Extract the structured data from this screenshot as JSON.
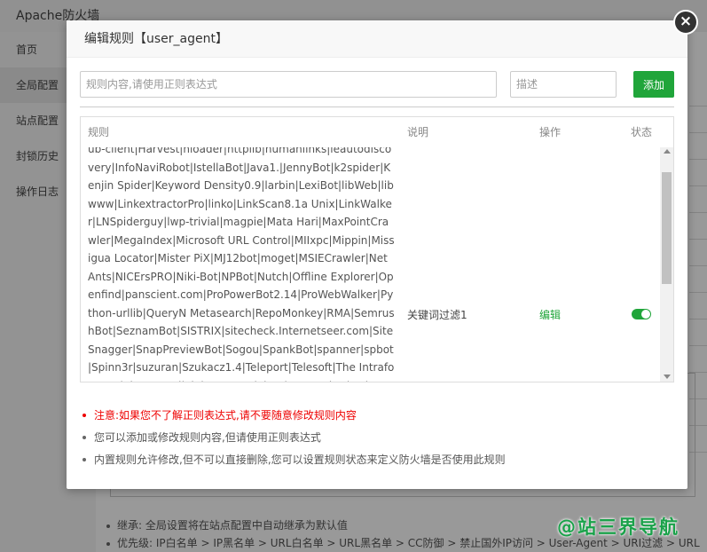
{
  "app": {
    "title": "Apache防火墙",
    "sidebar": [
      "首页",
      "全局配置",
      "站点配置",
      "封锁历史",
      "操作日志"
    ],
    "bottom_notes": [
      "继承: 全局设置将在站点配置中自动继承为默认值",
      "优先级: IP白名单 > IP黑名单 > URL白名单 > URL黑名单 > CC防御 > 禁止国外IP访问 > User-Agent > URI过滤 > URL"
    ],
    "bottom_fragment": "-Agent > URI过滤 > URL"
  },
  "watermark": "@站三界导航",
  "modal": {
    "title": "编辑规则【user_agent】",
    "close_symbol": "×",
    "rule_input": {
      "placeholder": "规则内容,请使用正则表达式",
      "value": ""
    },
    "desc_input": {
      "placeholder": "描述",
      "value": ""
    },
    "add_button": "添加",
    "table": {
      "headers": {
        "rule": "规则",
        "desc": "说明",
        "op": "操作",
        "status": "状态"
      },
      "rows": [
        {
          "rule": "ub-client|Harvest|hloader|httplib|humanlinks|ieautodiscovery|InfoNaviRobot|IstellaBot|Java1.|JennyBot|k2spider|Kenjin Spider|Keyword Density0.9|larbin|LexiBot|libWeb|libwww|LinkextractorPro|linko|LinkScan8.1a Unix|LinkWalker|LNSpiderguy|lwp-trivial|magpie|Mata Hari|MaxPointCrawler|MegaIndex|Microsoft URL Control|MIIxpc|Mippin|Missigua Locator|Mister PiX|MJ12bot|moget|MSIECrawler|NetAnts|NICErsPRO|Niki-Bot|NPBot|Nutch|Offline Explorer|Openfind|panscient.com|ProPowerBot2.14|ProWebWalker|Python-urllib|QueryN Metasearch|RepoMonkey|RMA|SemrushBot|SeznamBot|SISTRIX|sitecheck.Internetseer.com|SiteSnagger|SnapPreviewBot|Sogou|SpankBot|spanner|spbot|Spinn3r|suzuran|Szukacz1.4|Teleport|Telesoft|The Intraformant|TheNomad|TightTwatBot|Titan|True_Robot|turingos|TurnitinBot|UbiCrawler|UnisterBot|URLy Warning|VCI|WBSearchBot|Web Downloader6.9|WebAuto|WebBandit|WebCopier|WebEnhancer|Webmast",
          "desc": "关键词过滤1",
          "op": "编辑",
          "enabled": true
        }
      ]
    },
    "notes": [
      {
        "text": "注意:如果您不了解正则表达式,请不要随意修改规则内容",
        "warn": true
      },
      {
        "text": "您可以添加或修改规则内容,但请使用正则表达式",
        "warn": false
      },
      {
        "text": "内置规则允许修改,但不可以直接删除,您可以设置规则状态来定义防火墙是否使用此规则",
        "warn": false
      }
    ]
  },
  "colors": {
    "accent": "#20a53a",
    "warn": "#e00000",
    "close_bg": "#333333"
  }
}
